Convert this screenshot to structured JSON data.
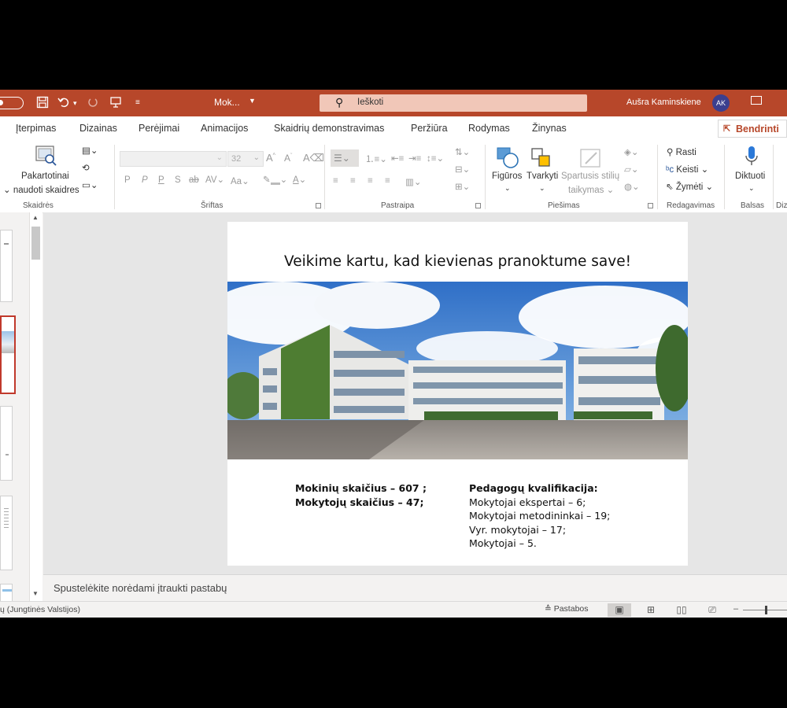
{
  "titlebar": {
    "doc_title": "Mok...",
    "search_placeholder": "Ieškoti",
    "user_name": "Aušra Kaminskiene",
    "user_initials": "AK",
    "accent": "#b7472a"
  },
  "menu": {
    "tabs": [
      "Įterpimas",
      "Dizainas",
      "Perėjimai",
      "Animacijos",
      "Skaidrių demonstravimas",
      "Peržiūra",
      "Rodymas",
      "Žinynas"
    ],
    "share_label": "Bendrinti"
  },
  "ribbon": {
    "slides": {
      "reuse_label_1": "Pakartotinai",
      "reuse_label_2": "naudoti skaidres",
      "group_label": "Skaidrės"
    },
    "font": {
      "size_placeholder": "32",
      "group_label": "Šriftas",
      "format_letters": [
        "P",
        "P",
        "P",
        "S",
        "ab"
      ]
    },
    "paragraph": {
      "group_label": "Pastraipa"
    },
    "drawing": {
      "shapes_label": "Figūros",
      "arrange_label": "Tvarkyti",
      "quick_styles_label_1": "Spartusis stilių",
      "quick_styles_label_2": "taikymas",
      "group_label": "Piešimas"
    },
    "editing": {
      "find_label": "Rasti",
      "replace_label": "Keisti",
      "select_label": "Žymėti",
      "group_label": "Redagavimas"
    },
    "voice": {
      "dictate_label": "Diktuoti",
      "group_label": "Balsas",
      "next_group_label": "Diz"
    }
  },
  "slide": {
    "title": "Veikime kartu, kad kievienas pranoktume save!",
    "left_stats": [
      "Mokinių skaičius – 607 ;",
      "Mokytojų skaičius – 47;"
    ],
    "right_heading": "Pedagogų kvalifikacija:",
    "right_lines": [
      "Mokytojai ekspertai – 6;",
      "Mokytojai metodininkai – 19;",
      "Vyr. mokytojai – 17;",
      "Mokytojai – 5."
    ]
  },
  "notes": {
    "placeholder": "Spustelėkite norėdami įtraukti pastabų"
  },
  "status": {
    "language": "ų (Jungtinės Valstijos)",
    "notes_label": "Pastabos",
    "zoom_minus": "–"
  }
}
